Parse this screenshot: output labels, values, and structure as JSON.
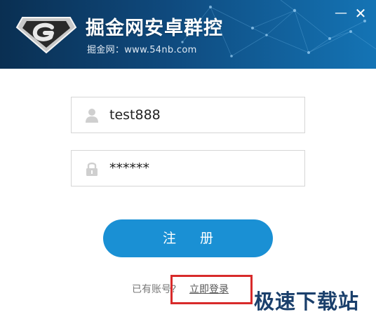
{
  "header": {
    "title": "掘金网安卓群控",
    "subtitle": "掘金网：www.54nb.com",
    "minimize_glyph": "—",
    "close_glyph": "✕",
    "logo_icon": "g-shield-logo"
  },
  "form": {
    "username": {
      "value": "test888",
      "icon": "user-icon"
    },
    "password": {
      "value": "******",
      "icon": "lock-icon"
    },
    "register_label": "注 册"
  },
  "footer": {
    "question": "已有账号?",
    "login_link": "立即登录"
  },
  "watermark": "极速下载站",
  "colors": {
    "header_dark": "#0a2f52",
    "header_light": "#1474b5",
    "button": "#1a90d4",
    "highlight": "#d82a2a"
  }
}
